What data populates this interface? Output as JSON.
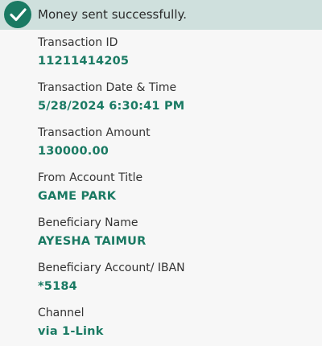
{
  "banner": {
    "icon": "check-circle-icon",
    "message": "Money sent successfully."
  },
  "colors": {
    "accent": "#1a7a63",
    "banner_bg": "#cfe0dd",
    "page_bg": "#f7f7f7"
  },
  "details": [
    {
      "label": "Transaction ID",
      "value": "11211414205"
    },
    {
      "label": "Transaction Date & Time",
      "value": "5/28/2024 6:30:41 PM"
    },
    {
      "label": "Transaction Amount",
      "value": "130000.00"
    },
    {
      "label": "From Account Title",
      "value": "GAME PARK"
    },
    {
      "label": "Beneficiary Name",
      "value": "AYESHA TAIMUR"
    },
    {
      "label": "Beneficiary Account/ IBAN",
      "value": "*5184"
    },
    {
      "label": "Channel",
      "value": "via 1-Link"
    }
  ]
}
